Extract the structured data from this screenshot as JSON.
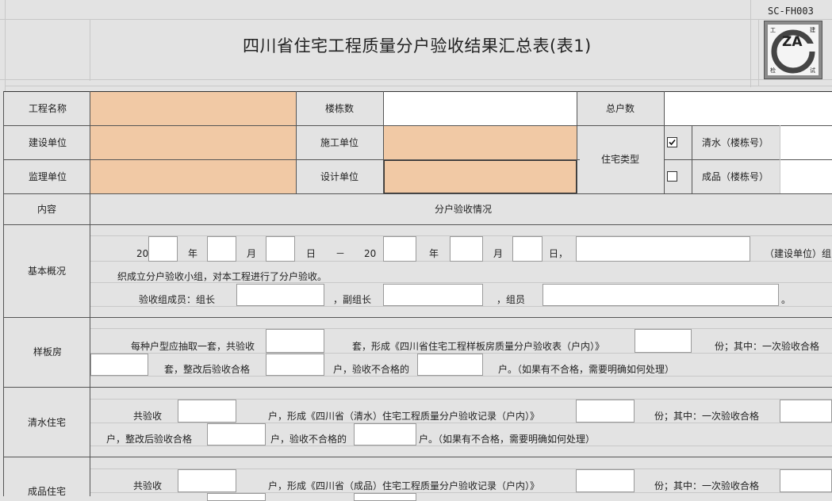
{
  "form_code": "SC-FH003",
  "title": "四川省住宅工程质量分户验收结果汇总表(表1)",
  "logo": {
    "text": "ZA",
    "corners": [
      "工",
      "建",
      "检",
      "试"
    ]
  },
  "header": {
    "project_name": "工程名称",
    "building_count": "楼栋数",
    "household_total": "总户数",
    "construction_unit": "建设单位",
    "contractor": "施工单位",
    "housing_type": "住宅类型",
    "bare": "清水（楼栋号）",
    "finished": "成品（楼栋号）",
    "supervision_unit": "监理单位",
    "design_unit": "设计单位",
    "bare_checked": true,
    "finished_checked": false
  },
  "sections": {
    "content": "内容",
    "inspection_status": "分户验收情况",
    "basic": "基本概况",
    "sample": "样板房",
    "bare_housing": "清水住宅",
    "finished_housing": "成品住宅"
  },
  "basic": {
    "year1": "20",
    "year": "年",
    "month": "月",
    "day": "日",
    "dash": "－",
    "year2": "20",
    "day_comma": "日，",
    "unit_note": "（建设单位）组",
    "line2": "织成立分户验收小组，对本工程进行了分户验收。",
    "members": "验收组成员：组长",
    "deputy": "，副组长",
    "member": "，组员",
    "period": "。"
  },
  "sample": {
    "l1a": "每种户型应抽取一套，共验收",
    "l1b": "套，形成《四川省住宅工程样板房质量分户验收表（户内）》",
    "l1c": "份；其中：一次验收合格",
    "l2a": "套，整改后验收合格",
    "l2b": "户，验收不合格的",
    "l2c": "户。（如果有不合格，需要明确如何处理）"
  },
  "bare": {
    "l1a": "共验收",
    "l1b": "户，形成《四川省（清水）住宅工程质量分户验收记录（户内）》",
    "l1c": "份；其中：一次验收合格",
    "l2a": "户，整改后验收合格",
    "l2b": "户，验收不合格的",
    "l2c": "户。（如果有不合格，需要明确如何处理）"
  },
  "finished": {
    "l1a": "共验收",
    "l1b": "户，形成《四川省（成品）住宅工程质量分户验收记录（户内）》",
    "l1c": "份；其中：一次验收合格"
  }
}
